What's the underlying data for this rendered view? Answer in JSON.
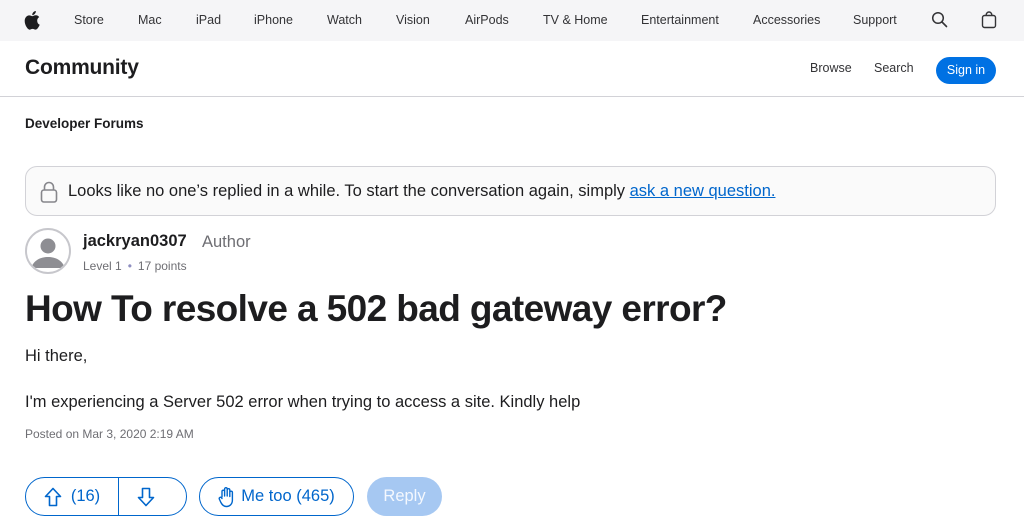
{
  "globalnav": {
    "items": [
      {
        "label": "Store"
      },
      {
        "label": "Mac"
      },
      {
        "label": "iPad"
      },
      {
        "label": "iPhone"
      },
      {
        "label": "Watch"
      },
      {
        "label": "Vision"
      },
      {
        "label": "AirPods"
      },
      {
        "label": "TV & Home"
      },
      {
        "label": "Entertainment"
      },
      {
        "label": "Accessories"
      },
      {
        "label": "Support"
      }
    ],
    "icons": {
      "logo": "apple-logo-icon",
      "search": "search-icon",
      "bag": "shopping-bag-icon"
    }
  },
  "community": {
    "title": "Community",
    "browse_label": "Browse",
    "search_label": "Search",
    "signin_label": "Sign in"
  },
  "breadcrumb": "Developer Forums",
  "notice": {
    "text": "Looks like no one’s replied in a while. To start the conversation again, simply ",
    "link_text": "ask a new question.",
    "icon": "lock-icon"
  },
  "author": {
    "name": "jackryan0307",
    "role": "Author",
    "level": "Level 1",
    "points": "17 points"
  },
  "post": {
    "title": "How To resolve a 502 bad gateway error?",
    "greeting": "Hi there,",
    "body": "I'm experiencing a Server 502 error when trying to access a site. Kindly help",
    "date": "Posted on Mar 3, 2020 2:19 AM"
  },
  "actions": {
    "upvote_count": "(16)",
    "metoo_label": "Me too (465)",
    "reply_label": "Reply"
  },
  "colors": {
    "accent": "#0071e3",
    "link": "#0066cc",
    "reply_disabled": "#a6c8f2"
  }
}
